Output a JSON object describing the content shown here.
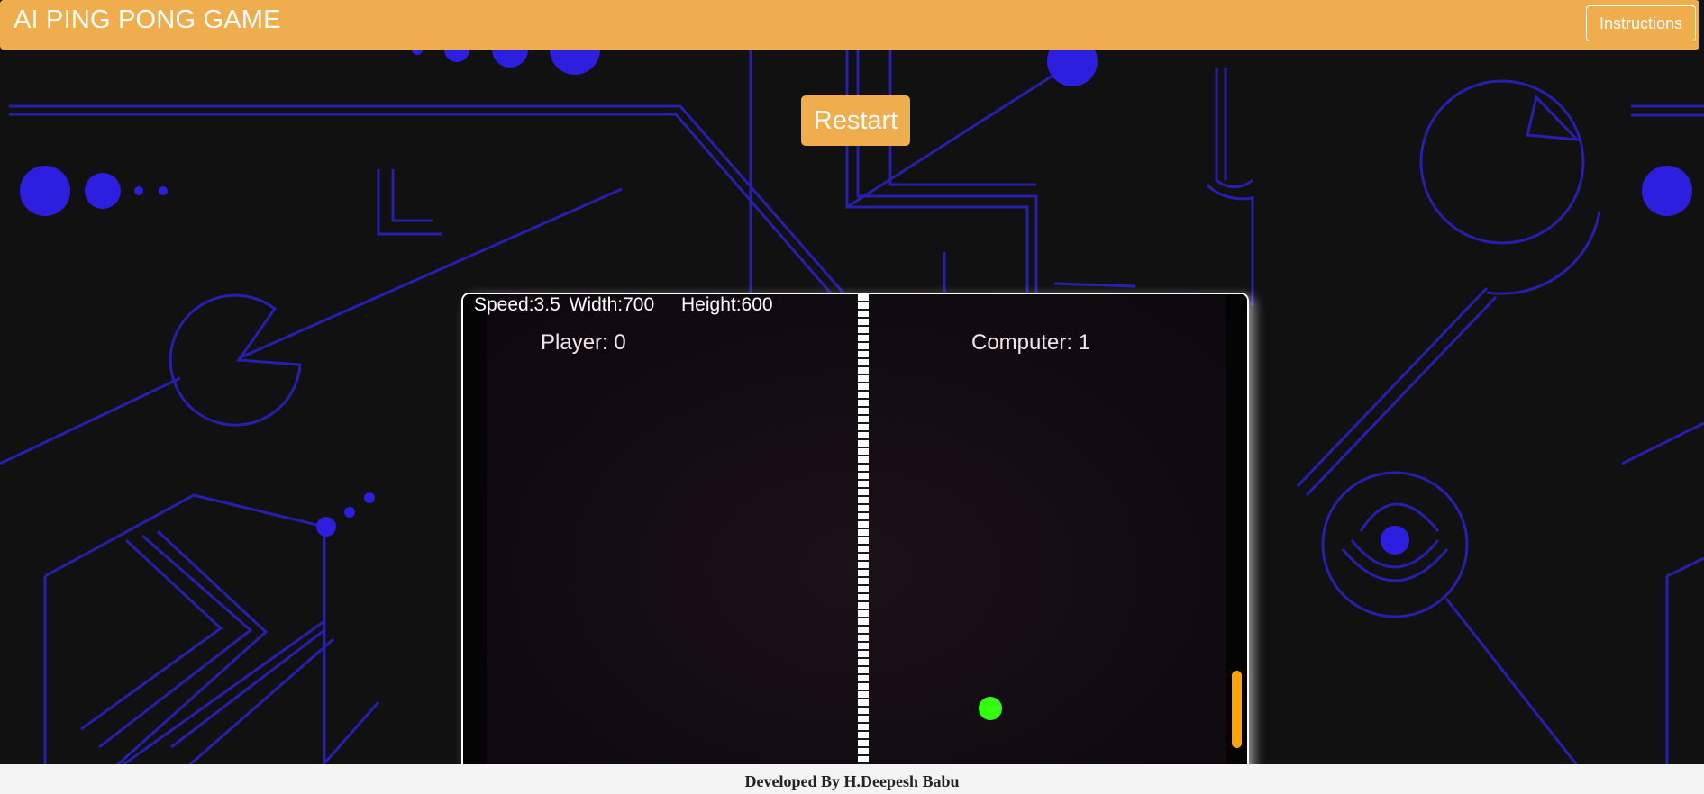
{
  "header": {
    "title": "AI PING PONG GAME",
    "instructions_label": "Instructions"
  },
  "controls": {
    "restart_label": "Restart"
  },
  "game": {
    "speed_text": "Speed:3.5",
    "width_text": "Width:700",
    "height_text": "Height:600",
    "player_score_text": "Player: 0",
    "computer_score_text": "Computer: 1",
    "player_score": 0,
    "computer_score": 1,
    "ball_color": "#33ff11",
    "paddle_color": "#ffa200"
  },
  "footer": {
    "credit": "Developed By H.Deepesh Babu"
  },
  "colors": {
    "accent": "#f0ad4e",
    "background": "#111111",
    "circuit_lines": "#2a22cc",
    "circuit_dots": "#2c1fe0"
  }
}
